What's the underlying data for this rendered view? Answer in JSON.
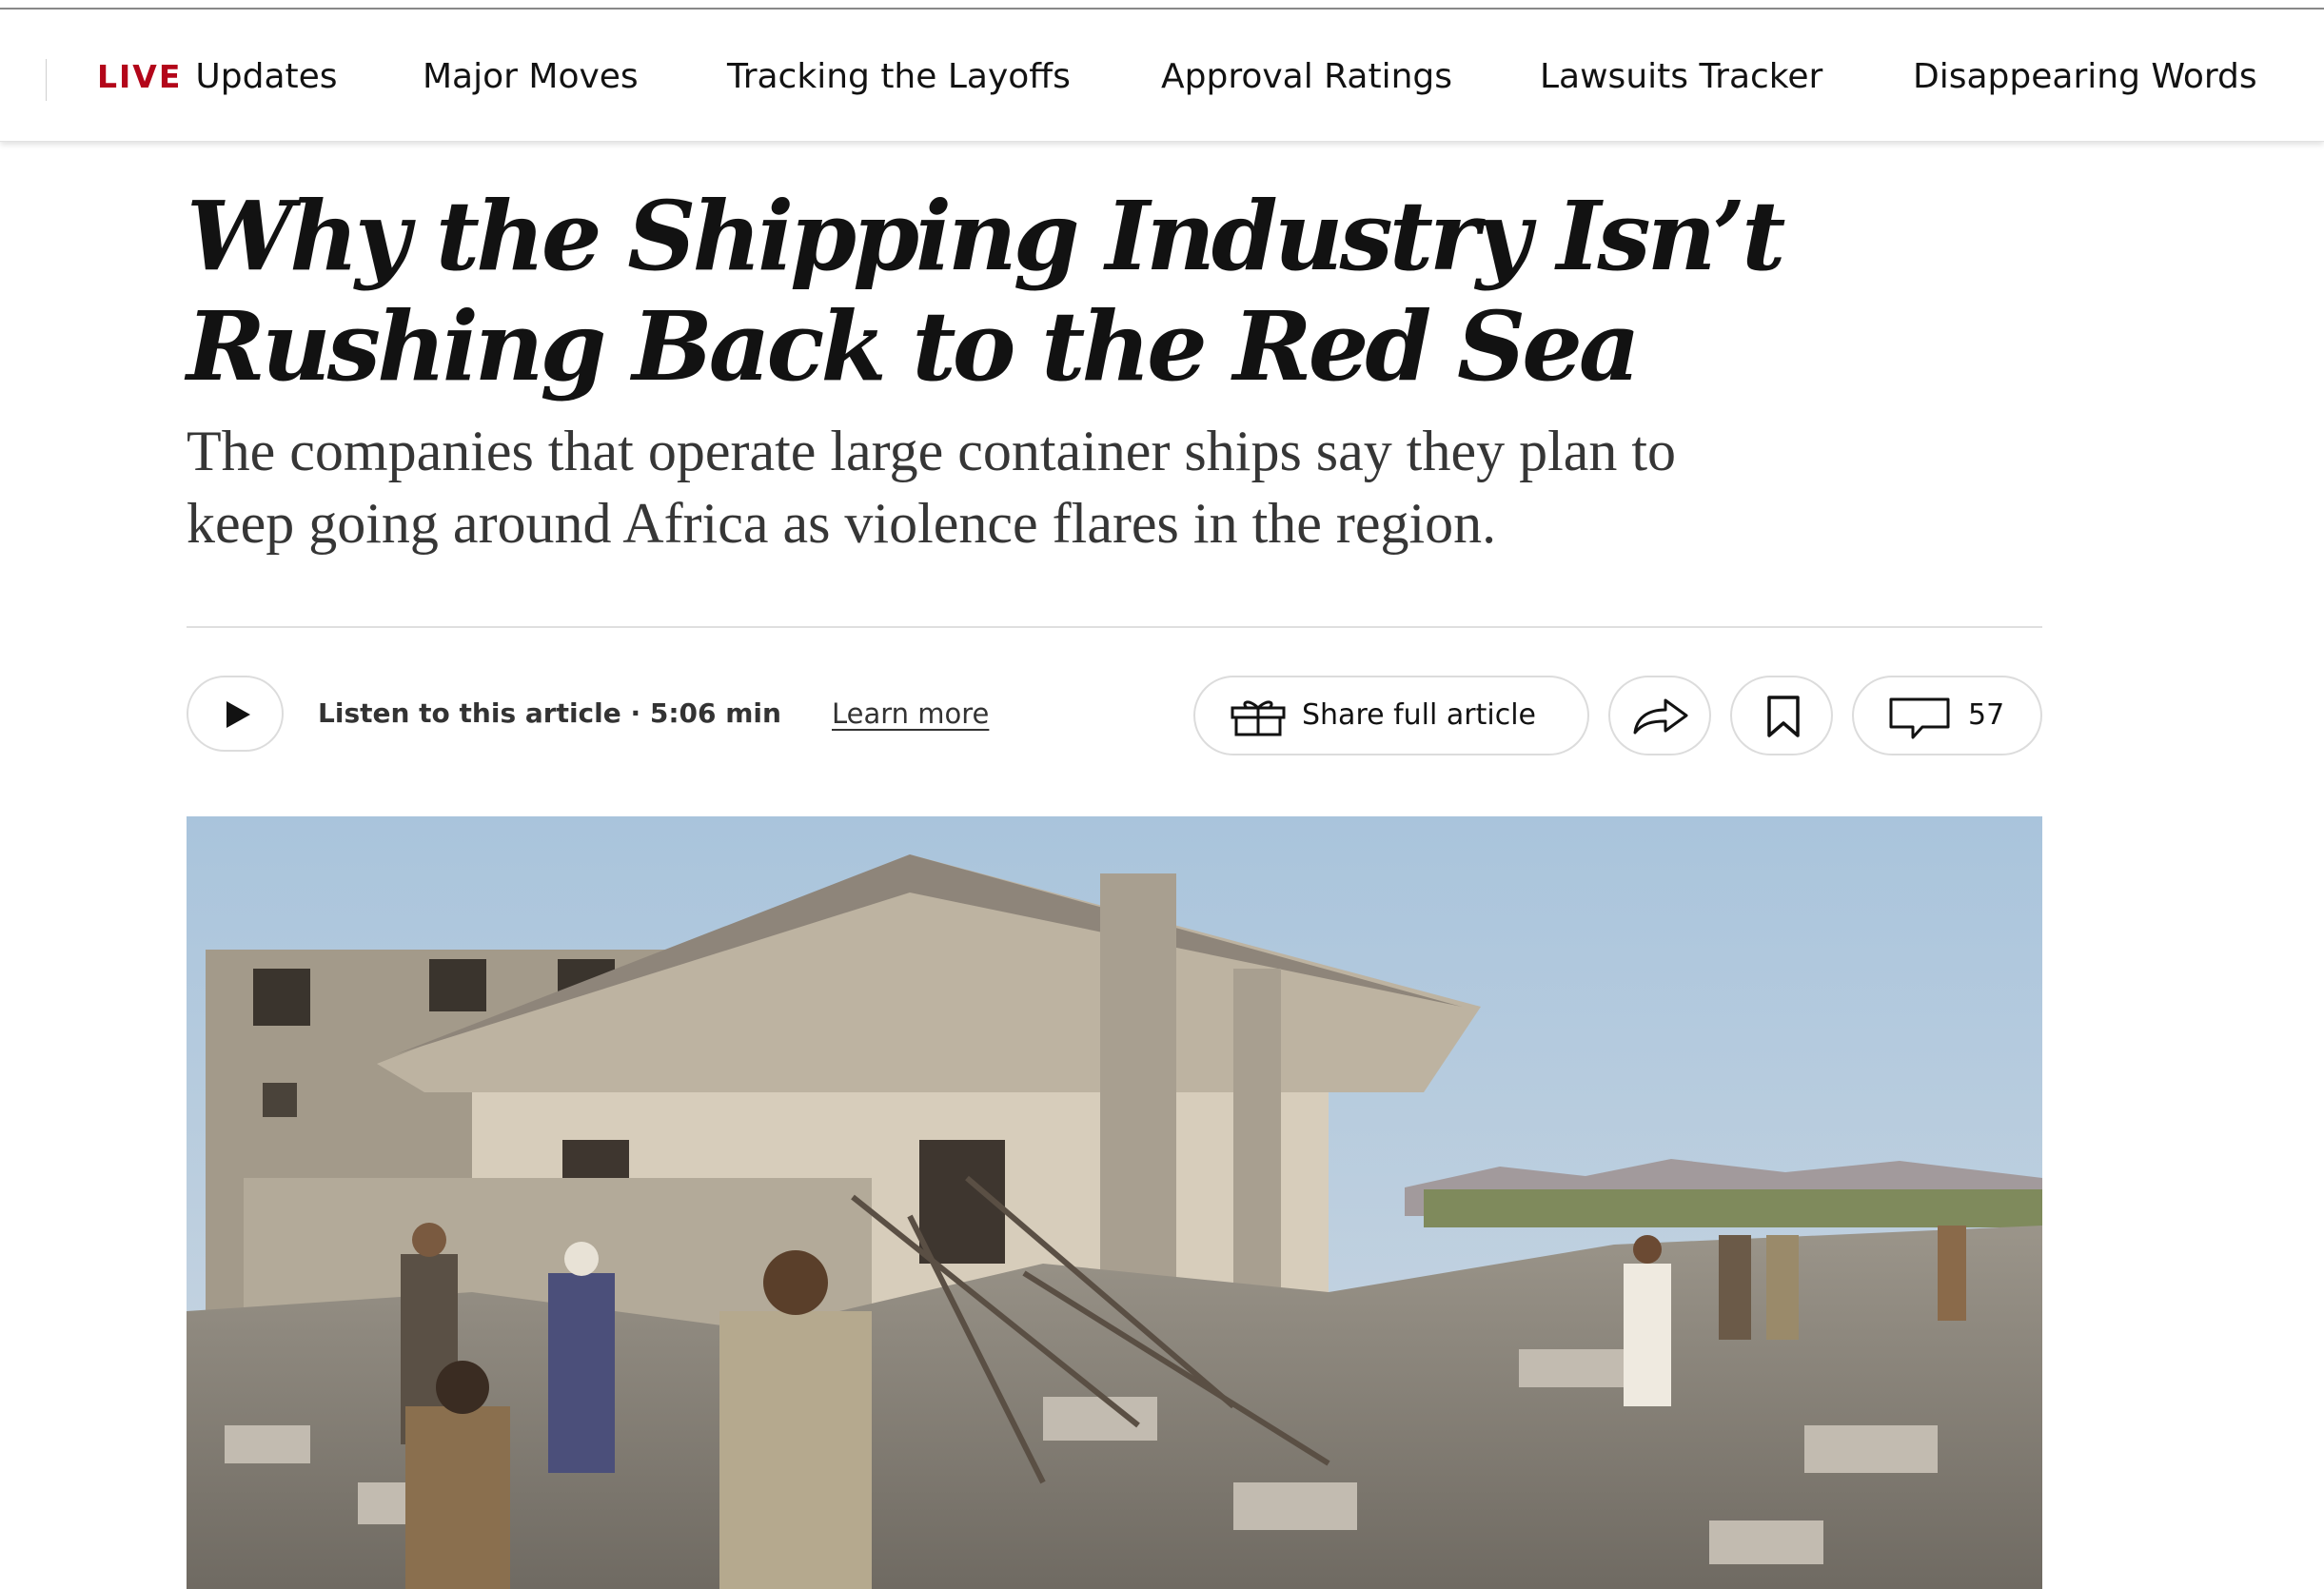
{
  "nav": {
    "live_label": "LIVE",
    "items": [
      "Updates",
      "Major Moves",
      "Tracking the Layoffs",
      "Approval Ratings",
      "Lawsuits Tracker",
      "Disappearing Words"
    ]
  },
  "article": {
    "headline_line1": "Why the Shipping Industry Isn’t",
    "headline_line2": "Rushing Back to the Red Sea",
    "summary_line1": "The companies that operate large container ships say they plan to",
    "summary_line2": "keep going around Africa as violence flares in the region."
  },
  "toolbar": {
    "listen_text": "Listen to this article · 5:06 min",
    "learn_more": "Learn more",
    "share_full": "Share full article",
    "comments_count": "57"
  },
  "icons": {
    "play": "play-icon",
    "gift": "gift-icon",
    "share": "share-arrow-icon",
    "bookmark": "bookmark-icon",
    "comments": "comment-bubble-icon"
  },
  "colors": {
    "live_red": "#b3061a",
    "text": "#121212",
    "subhead": "#363636",
    "border": "#dcdcdc"
  }
}
